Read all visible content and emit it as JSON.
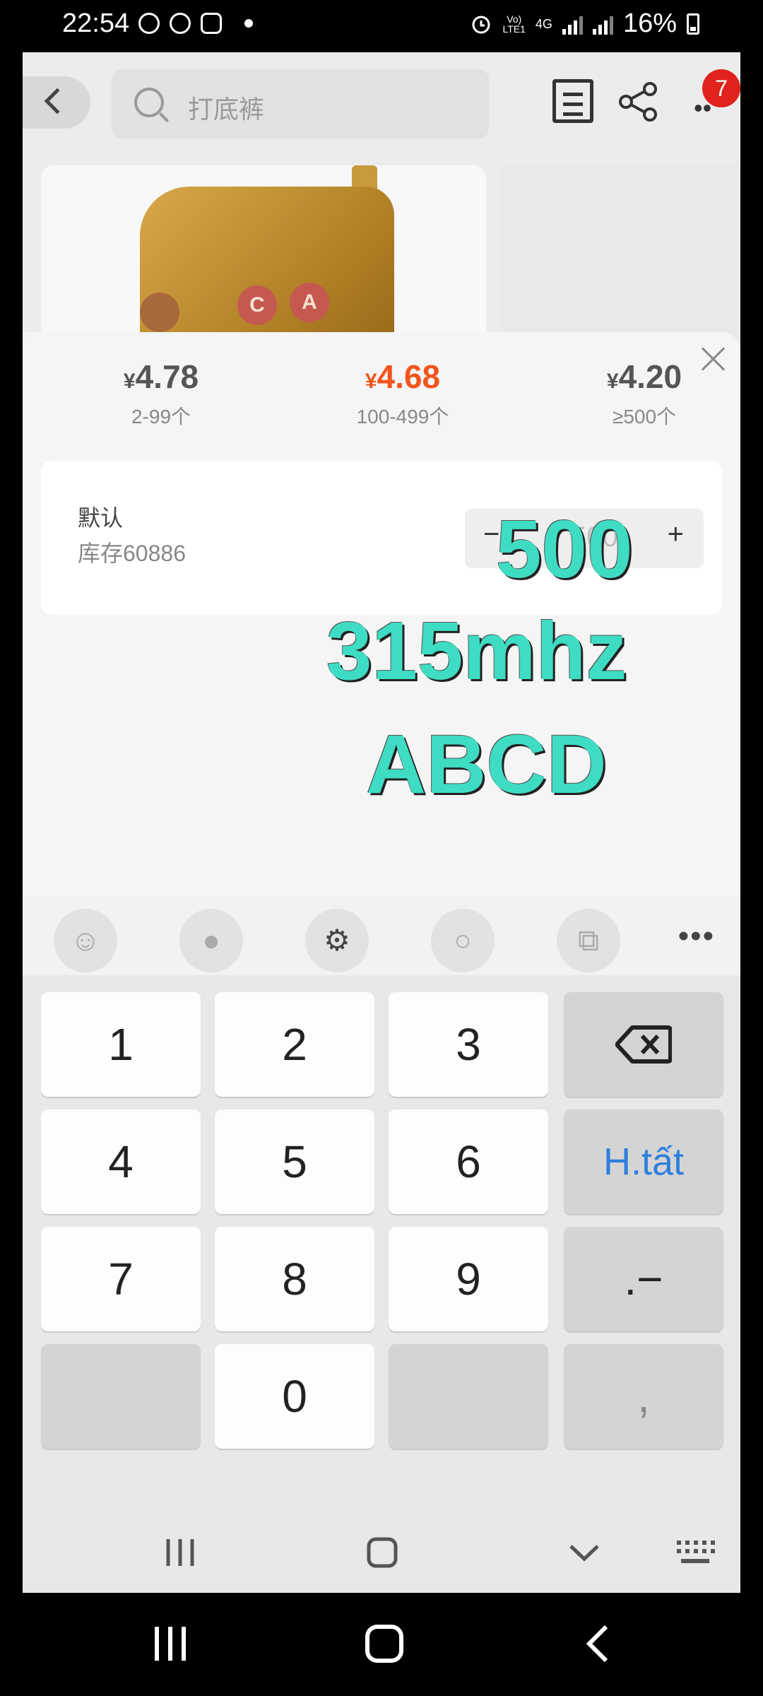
{
  "status_bar": {
    "time": "22:54",
    "battery": "16%",
    "network_top": "Vo)",
    "network_bottom": "LTE1",
    "generation": "4G"
  },
  "header": {
    "search_placeholder": "打底裤",
    "cart_badge": "7"
  },
  "product_image_labels": [
    "C",
    "A"
  ],
  "price_tiers": [
    {
      "currency": "¥",
      "price": "4.78",
      "range": "2-99个",
      "active": false
    },
    {
      "currency": "¥",
      "price": "4.68",
      "range": "100-499个",
      "active": true
    },
    {
      "currency": "¥",
      "price": "4.20",
      "range": "≥500个",
      "active": false
    }
  ],
  "sku": {
    "name": "默认",
    "stock": "库存60886",
    "minus": "−",
    "plus": "+",
    "quantity": "500"
  },
  "overlay_text": [
    "500",
    "315mhz",
    "ABCD"
  ],
  "keyboard": {
    "rows": [
      [
        "1",
        "2",
        "3",
        "⌫"
      ],
      [
        "4",
        "5",
        "6",
        "H.tất"
      ],
      [
        "7",
        "8",
        "9",
        ".−"
      ],
      [
        "",
        "0",
        "",
        ","
      ]
    ]
  },
  "colors": {
    "active_price": "#f2541b",
    "overlay": "#3fdcc4",
    "done_key": "#2e7fdc",
    "badge": "#e0231c"
  }
}
